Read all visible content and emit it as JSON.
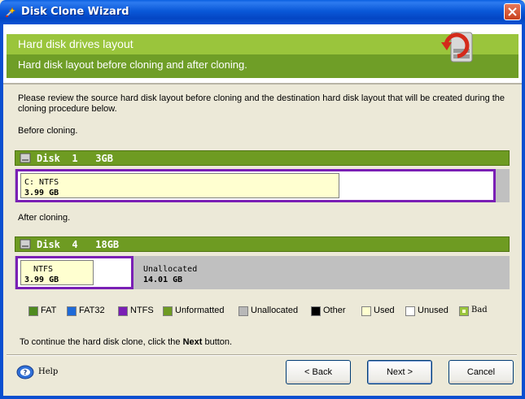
{
  "window": {
    "title": "Disk Clone Wizard"
  },
  "header": {
    "title": "Hard disk drives layout",
    "subtitle": "Hard disk layout before cloning and after cloning."
  },
  "intro": "Please review the source hard disk layout before cloning and the destination hard disk layout that will be created during the cloning procedure below.",
  "before": {
    "label": "Before cloning.",
    "disk_label": "Disk  1   3GB",
    "partition": {
      "name": "C:   NTFS",
      "size": "3.99 GB"
    }
  },
  "after": {
    "label": "After cloning.",
    "disk_label": "Disk  4   18GB",
    "partition": {
      "name": "NTFS",
      "size": "3.99 GB"
    },
    "unallocated": {
      "name": "Unallocated",
      "size": "14.01 GB"
    }
  },
  "legend": [
    {
      "label": "FAT",
      "color": "#4e8a1e"
    },
    {
      "label": "FAT32",
      "color": "#1e6ad8"
    },
    {
      "label": "NTFS",
      "color": "#7a1fb5"
    },
    {
      "label": "Unformatted",
      "color": "#6e9b22"
    },
    {
      "label": "Unallocated",
      "color": "#b8b8b8"
    },
    {
      "label": "Other",
      "color": "#000000"
    },
    {
      "label": "Used",
      "color": "#ffffd0"
    },
    {
      "label": "Unused",
      "color": "#ffffff"
    },
    {
      "label": "Bad",
      "color": "#9ac53c"
    }
  ],
  "footer_text": {
    "before": "To continue the hard disk clone, click the ",
    "bold": "Next",
    "after": " button."
  },
  "buttons": {
    "help": "Help",
    "back": "< Back",
    "next": "Next >",
    "cancel": "Cancel"
  }
}
